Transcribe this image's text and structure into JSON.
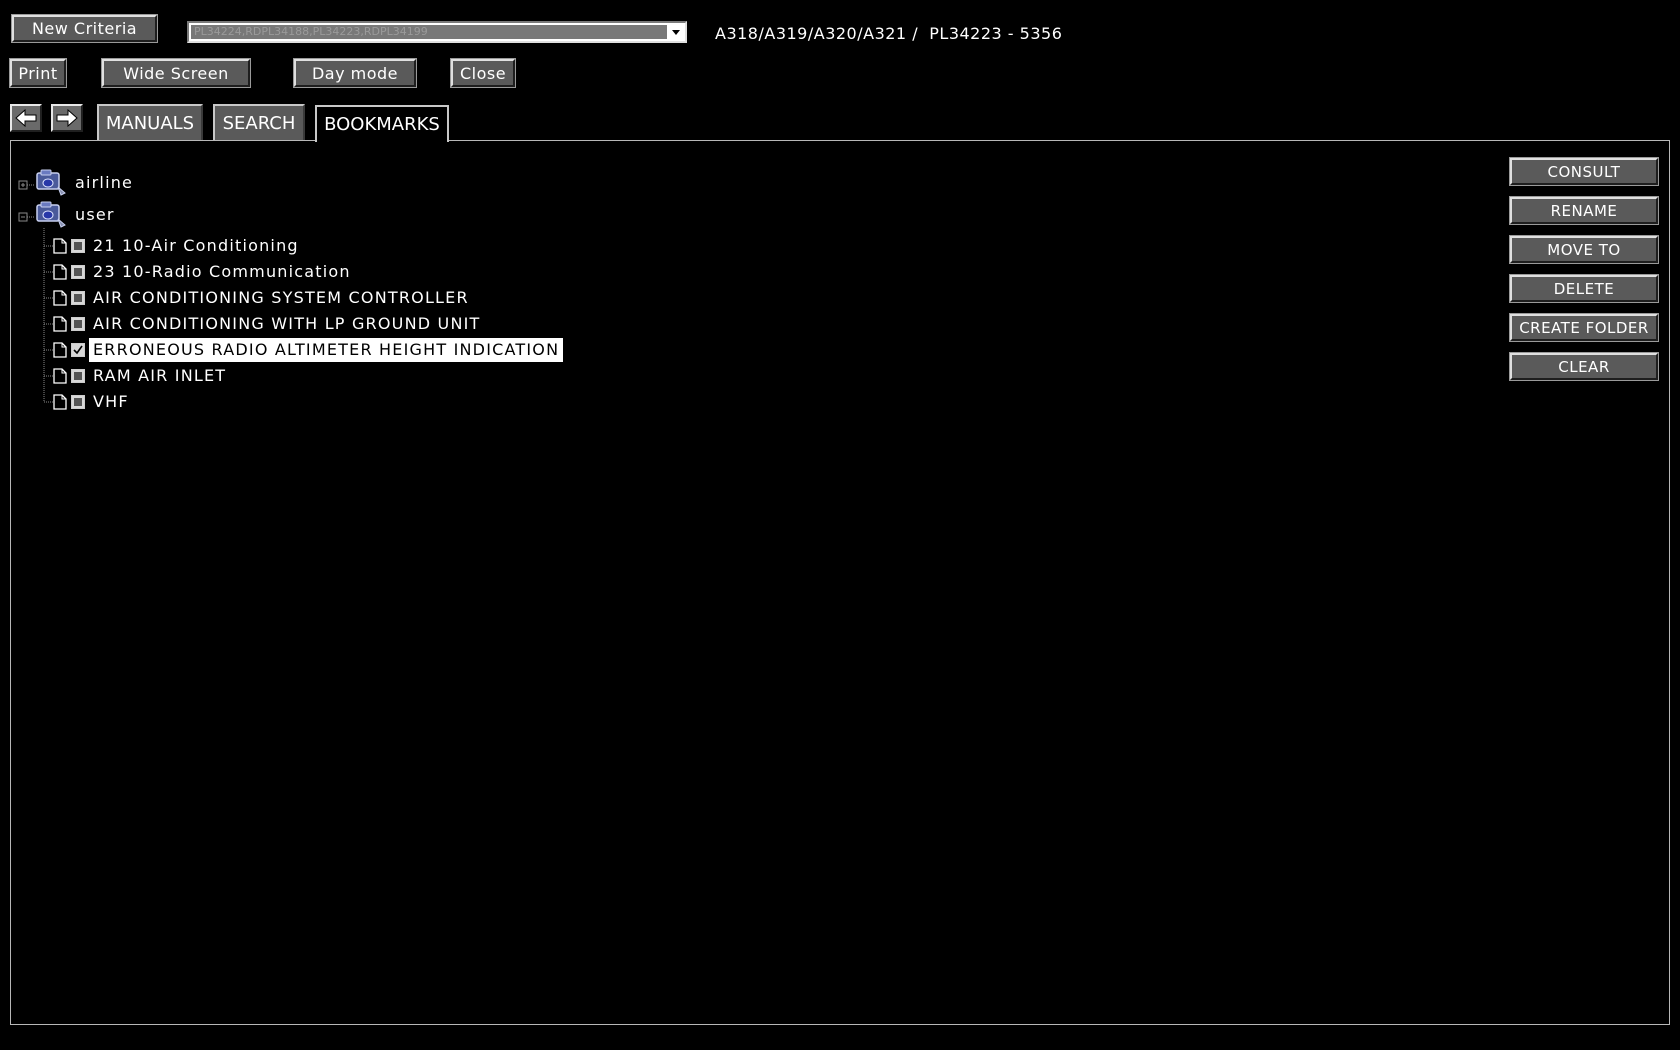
{
  "toolbar": {
    "new_criteria": "New Criteria",
    "print": "Print",
    "wide_screen": "Wide Screen",
    "day_mode": "Day mode",
    "close": "Close"
  },
  "effectivity": {
    "selected": "PL34224,RDPL34188,PL34223,RDPL34199"
  },
  "aircraft_info": "A318/A319/A320/A321 /  PL34223 - 5356",
  "tabs": [
    {
      "label": "MANUALS",
      "active": false
    },
    {
      "label": "SEARCH",
      "active": false
    },
    {
      "label": "BOOKMARKS",
      "active": true
    }
  ],
  "tree": {
    "folders": [
      {
        "label": "airline",
        "expanded": false
      },
      {
        "label": "user",
        "expanded": true
      }
    ],
    "bookmarks": [
      {
        "label": "21 10-Air Conditioning",
        "checked": false
      },
      {
        "label": "23 10-Radio Communication",
        "checked": false
      },
      {
        "label": "AIR CONDITIONING SYSTEM CONTROLLER",
        "checked": false
      },
      {
        "label": "AIR CONDITIONING WITH LP GROUND UNIT",
        "checked": false
      },
      {
        "label": "ERRONEOUS RADIO ALTIMETER HEIGHT INDICATION",
        "checked": true,
        "selected": true
      },
      {
        "label": "RAM AIR INLET",
        "checked": false
      },
      {
        "label": "VHF",
        "checked": false
      }
    ]
  },
  "actions": {
    "consult": "CONSULT",
    "rename": "RENAME",
    "move_to": "MOVE TO",
    "delete": "DELETE",
    "create_folder": "CREATE FOLDER",
    "clear": "CLEAR"
  },
  "icons": {
    "back": "arrow-left-icon",
    "forward": "arrow-right-icon",
    "folder": "folder-network-icon",
    "document": "document-icon"
  }
}
